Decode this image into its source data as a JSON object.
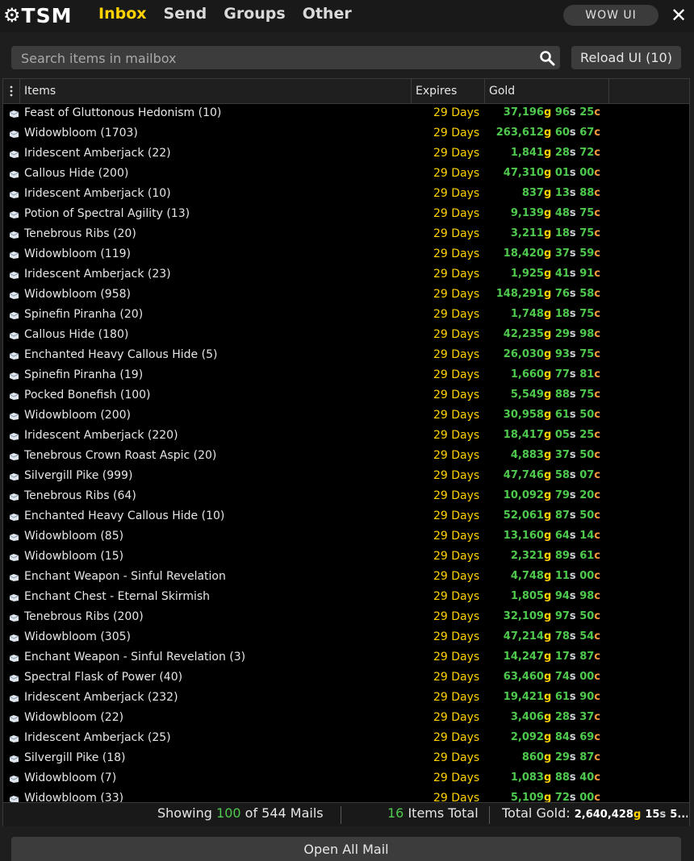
{
  "header": {
    "logo_text": "TSM",
    "tabs": [
      {
        "label": "Inbox",
        "active": true
      },
      {
        "label": "Send",
        "active": false
      },
      {
        "label": "Groups",
        "active": false
      },
      {
        "label": "Other",
        "active": false
      }
    ],
    "wow_ui_label": "WOW UI",
    "close_icon": "close-icon"
  },
  "search": {
    "placeholder": "Search items in mailbox",
    "value": "",
    "reload_label": "Reload UI (10)"
  },
  "table": {
    "columns": [
      "Items",
      "Expires",
      "Gold"
    ],
    "rows": [
      {
        "item": "Feast of Gluttonous Hedonism (10)",
        "expires": "29 Days",
        "gold": "37,196",
        "silver": "96",
        "copper": "25"
      },
      {
        "item": "Widowbloom (1703)",
        "expires": "29 Days",
        "gold": "263,612",
        "silver": "60",
        "copper": "67"
      },
      {
        "item": "Iridescent Amberjack (22)",
        "expires": "29 Days",
        "gold": "1,841",
        "silver": "28",
        "copper": "72"
      },
      {
        "item": "Callous Hide (200)",
        "expires": "29 Days",
        "gold": "47,310",
        "silver": "01",
        "copper": "00"
      },
      {
        "item": "Iridescent Amberjack (10)",
        "expires": "29 Days",
        "gold": "837",
        "silver": "13",
        "copper": "88"
      },
      {
        "item": "Potion of Spectral Agility (13)",
        "expires": "29 Days",
        "gold": "9,139",
        "silver": "48",
        "copper": "75"
      },
      {
        "item": "Tenebrous Ribs (20)",
        "expires": "29 Days",
        "gold": "3,211",
        "silver": "18",
        "copper": "75"
      },
      {
        "item": "Widowbloom (119)",
        "expires": "29 Days",
        "gold": "18,420",
        "silver": "37",
        "copper": "59"
      },
      {
        "item": "Iridescent Amberjack (23)",
        "expires": "29 Days",
        "gold": "1,925",
        "silver": "41",
        "copper": "91"
      },
      {
        "item": "Widowbloom (958)",
        "expires": "29 Days",
        "gold": "148,291",
        "silver": "76",
        "copper": "58"
      },
      {
        "item": "Spinefin Piranha (20)",
        "expires": "29 Days",
        "gold": "1,748",
        "silver": "18",
        "copper": "75"
      },
      {
        "item": "Callous Hide (180)",
        "expires": "29 Days",
        "gold": "42,235",
        "silver": "29",
        "copper": "98"
      },
      {
        "item": "Enchanted Heavy Callous Hide (5)",
        "expires": "29 Days",
        "gold": "26,030",
        "silver": "93",
        "copper": "75"
      },
      {
        "item": "Spinefin Piranha (19)",
        "expires": "29 Days",
        "gold": "1,660",
        "silver": "77",
        "copper": "81"
      },
      {
        "item": "Pocked Bonefish (100)",
        "expires": "29 Days",
        "gold": "5,549",
        "silver": "88",
        "copper": "75"
      },
      {
        "item": "Widowbloom (200)",
        "expires": "29 Days",
        "gold": "30,958",
        "silver": "61",
        "copper": "50"
      },
      {
        "item": "Iridescent Amberjack (220)",
        "expires": "29 Days",
        "gold": "18,417",
        "silver": "05",
        "copper": "25"
      },
      {
        "item": "Tenebrous Crown Roast Aspic (20)",
        "expires": "29 Days",
        "gold": "4,883",
        "silver": "37",
        "copper": "50"
      },
      {
        "item": "Silvergill Pike (999)",
        "expires": "29 Days",
        "gold": "47,746",
        "silver": "58",
        "copper": "07"
      },
      {
        "item": "Tenebrous Ribs (64)",
        "expires": "29 Days",
        "gold": "10,092",
        "silver": "79",
        "copper": "20"
      },
      {
        "item": "Enchanted Heavy Callous Hide (10)",
        "expires": "29 Days",
        "gold": "52,061",
        "silver": "87",
        "copper": "50"
      },
      {
        "item": "Widowbloom (85)",
        "expires": "29 Days",
        "gold": "13,160",
        "silver": "64",
        "copper": "14"
      },
      {
        "item": "Widowbloom (15)",
        "expires": "29 Days",
        "gold": "2,321",
        "silver": "89",
        "copper": "61"
      },
      {
        "item": "Enchant Weapon - Sinful Revelation",
        "expires": "29 Days",
        "gold": "4,748",
        "silver": "11",
        "copper": "00"
      },
      {
        "item": "Enchant Chest - Eternal Skirmish",
        "expires": "29 Days",
        "gold": "1,805",
        "silver": "94",
        "copper": "98"
      },
      {
        "item": "Tenebrous Ribs (200)",
        "expires": "29 Days",
        "gold": "32,109",
        "silver": "97",
        "copper": "50"
      },
      {
        "item": "Widowbloom (305)",
        "expires": "29 Days",
        "gold": "47,214",
        "silver": "78",
        "copper": "54"
      },
      {
        "item": "Enchant Weapon - Sinful Revelation (3)",
        "expires": "29 Days",
        "gold": "14,247",
        "silver": "17",
        "copper": "87"
      },
      {
        "item": "Spectral Flask of Power (40)",
        "expires": "29 Days",
        "gold": "63,460",
        "silver": "74",
        "copper": "00"
      },
      {
        "item": "Iridescent Amberjack (232)",
        "expires": "29 Days",
        "gold": "19,421",
        "silver": "61",
        "copper": "90"
      },
      {
        "item": "Widowbloom (22)",
        "expires": "29 Days",
        "gold": "3,406",
        "silver": "28",
        "copper": "37"
      },
      {
        "item": "Iridescent Amberjack (25)",
        "expires": "29 Days",
        "gold": "2,092",
        "silver": "84",
        "copper": "69"
      },
      {
        "item": "Silvergill Pike (18)",
        "expires": "29 Days",
        "gold": "860",
        "silver": "29",
        "copper": "87"
      },
      {
        "item": "Widowbloom (7)",
        "expires": "29 Days",
        "gold": "1,083",
        "silver": "88",
        "copper": "40"
      },
      {
        "item": "Widowbloom (33)",
        "expires": "29 Days",
        "gold": "5,109",
        "silver": "72",
        "copper": "00"
      }
    ]
  },
  "footer": {
    "showing_prefix": "Showing",
    "showing_count": "100",
    "showing_mid": "of 544 Mails",
    "items_count": "16",
    "items_label": "Items Total",
    "total_gold_label": "Total Gold:",
    "total_gold_gold": "2,640,428",
    "total_gold_silver": "15",
    "total_gold_rest": "5..."
  },
  "open_all_label": "Open All Mail",
  "units": {
    "gold": "g",
    "silver": "s",
    "copper": "c"
  },
  "colors": {
    "accent_tab": "#ffd200",
    "expires": "#ffd200",
    "gold_amount": "#4ec94e",
    "gold_unit": "#ffd200",
    "silver_unit": "#cfd3d6",
    "copper_unit": "#ff9a3c",
    "background": "#000000"
  },
  "icons": {
    "row": "envelope-icon",
    "search": "search-icon",
    "menu": "vertical-dots-icon",
    "logo": "gear-icon"
  }
}
